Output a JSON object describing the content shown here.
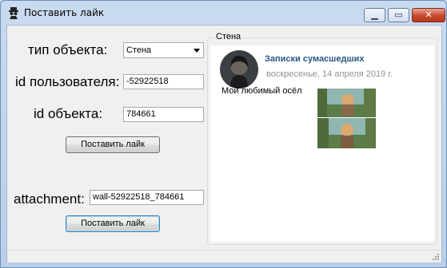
{
  "window": {
    "title": "Поставить лайк",
    "icon": "spy-icon",
    "minimize": "minimize-icon",
    "maximize": "maximize-icon",
    "close": "close-icon"
  },
  "form": {
    "object_type_label": "тип объекта:",
    "object_type_value": "Стена",
    "user_id_label": "id пользователя:",
    "user_id_value": "-52922518",
    "object_id_label": "id объекта:",
    "object_id_value": "784661",
    "like_button_1": "Поставить лайк",
    "attachment_label": "attachment:",
    "attachment_value": "wall-52922518_784661",
    "like_button_2": "Поставить лайк"
  },
  "wall": {
    "caption": "Стена",
    "post": {
      "author": "Записки сумасшедших",
      "date": "воскресенье, 14 апреля 2019 г.",
      "text": "Мой любимый осёл"
    }
  },
  "colors": {
    "link": "#2a5885",
    "date": "#939393",
    "window_frame": "#b9cfe9"
  }
}
